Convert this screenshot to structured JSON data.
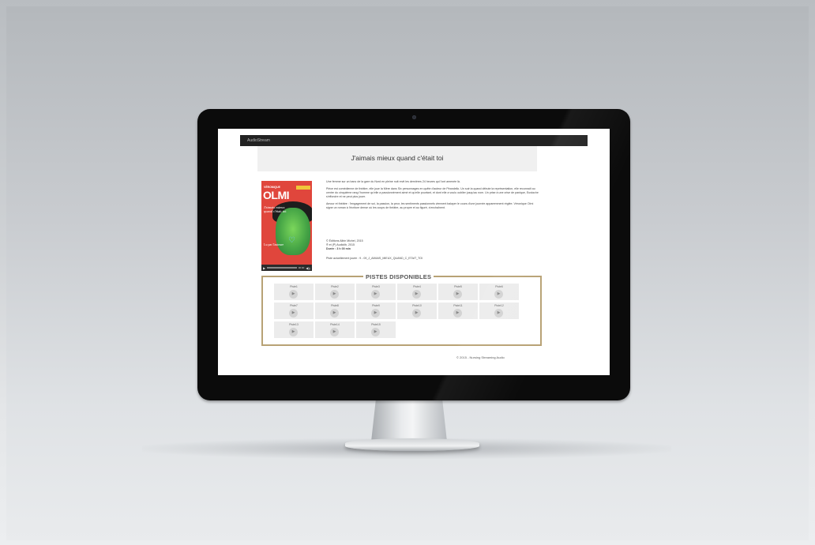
{
  "site": {
    "brand": "AudioStream"
  },
  "page": {
    "title": "J'aimais mieux quand c'était toi"
  },
  "cover": {
    "author_small": "VÉRONIQUE",
    "author_name": "OLMI",
    "book_title": "J'aimais mieux quand c'était toi",
    "read_by": "Lu par l'auteure",
    "heart_glyph": "♡"
  },
  "player": {
    "play_glyph": "▶",
    "time": "00:00",
    "volume_glyph": "◀))"
  },
  "description": {
    "paragraphs": [
      "Une femme sur un banc de la gare du Nord en pleine nuit revit les dernières 24 heures qui l'ont amenée là.",
      "Pièce est comédienne de théâtre, elle joue la Mère dans Six personnages en quête d'auteur de Pirandello. Un soir la quand débute la représentation, elle reconnaît au centre du cinquième rang l'homme qu'elle a passionnément aimé et qu'elle pourtant, et dont elle a voulu oublier jusqu'au nom. Un prise à une crise de panique, Eustache s'effondre et ne peut plus jouer.",
      "Amour et théâtre : l'engagement de soi, la passion, la peur, les sentiments passionnels viennent balayer le cours d'une journée apparemment réglée. Véronique Olmi signe un roman à l'écriture dense où les coups de théâtre, au propre et au figuré, s'enchaînent."
    ]
  },
  "meta": {
    "copyright_text": "© Éditions Albin Michel, 2015",
    "phonogram": "® et (P) Audiolib, 2015",
    "duration": "Durée : 3 h 00 min"
  },
  "now_playing": "Piste actuellement jouée : 9 - 09_J_AIMAIS_MIEUX_QUAND_C_ETAIT_TOI",
  "tracks": {
    "heading": "PISTES DISPONIBLES",
    "play_glyph": "▶",
    "items": [
      "Piste1",
      "Piste2",
      "Piste3",
      "Piste4",
      "Piste5",
      "Piste6",
      "Piste7",
      "Piste8",
      "Piste9",
      "Piste10",
      "Piste11",
      "Piste12",
      "Piste13",
      "Piste14",
      "Piste15"
    ]
  },
  "footer": {
    "copyright": "© 2015 - Nursing Streaming Audio"
  }
}
